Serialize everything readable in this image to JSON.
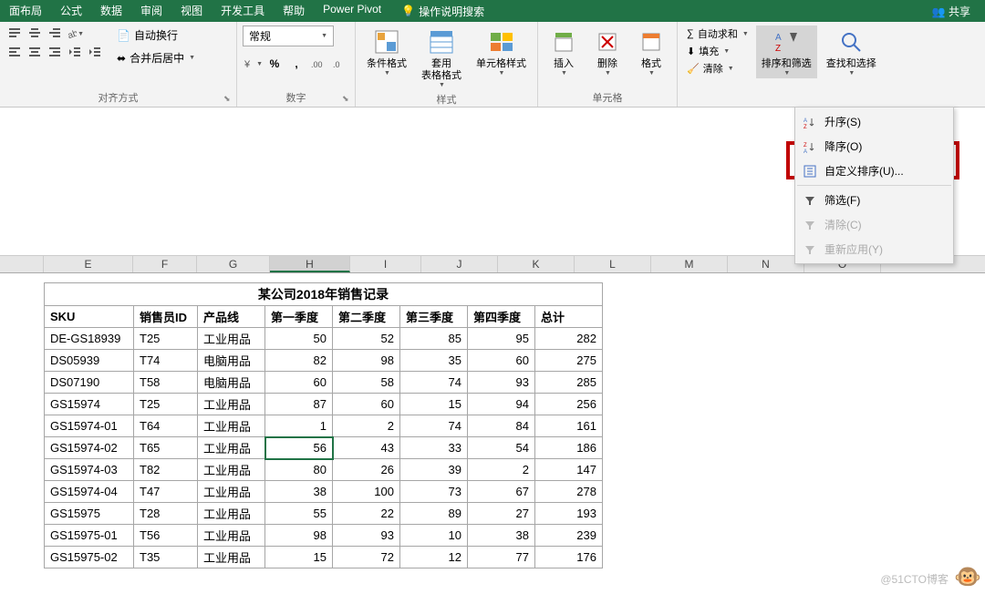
{
  "titlebar": {
    "tabs": [
      "面布局",
      "公式",
      "数据",
      "审阅",
      "视图",
      "开发工具",
      "帮助",
      "Power Pivot"
    ],
    "tell_me": "操作说明搜索",
    "share": "共享"
  },
  "ribbon": {
    "alignment": {
      "wrap": "自动换行",
      "merge": "合并后居中",
      "label": "对齐方式"
    },
    "number": {
      "format": "常规",
      "label": "数字"
    },
    "styles": {
      "cond": "条件格式",
      "table": "套用\n表格格式",
      "cell": "单元格样式",
      "label": "样式"
    },
    "cells": {
      "insert": "插入",
      "delete": "删除",
      "format": "格式",
      "label": "单元格"
    },
    "editing": {
      "sum": "自动求和",
      "fill": "填充",
      "clear": "清除",
      "sort": "排序和筛选",
      "find": "查找和选择"
    }
  },
  "menu": {
    "asc": "升序(S)",
    "desc": "降序(O)",
    "custom": "自定义排序(U)...",
    "filter": "筛选(F)",
    "clear": "清除(C)",
    "reapply": "重新应用(Y)"
  },
  "columns": [
    "E",
    "F",
    "G",
    "H",
    "I",
    "J",
    "K",
    "L",
    "M",
    "N",
    "O"
  ],
  "table": {
    "title": "某公司2018年销售记录",
    "headers": [
      "SKU",
      "销售员ID",
      "产品线",
      "第一季度",
      "第二季度",
      "第三季度",
      "第四季度",
      "总计"
    ],
    "rows": [
      [
        "DE-GS18939",
        "T25",
        "工业用品",
        50,
        52,
        85,
        95,
        282
      ],
      [
        "DS05939",
        "T74",
        "电脑用品",
        82,
        98,
        35,
        60,
        275
      ],
      [
        "DS07190",
        "T58",
        "电脑用品",
        60,
        58,
        74,
        93,
        285
      ],
      [
        "GS15974",
        "T25",
        "工业用品",
        87,
        60,
        15,
        94,
        256
      ],
      [
        "GS15974-01",
        "T64",
        "工业用品",
        1,
        2,
        74,
        84,
        161
      ],
      [
        "GS15974-02",
        "T65",
        "工业用品",
        56,
        43,
        33,
        54,
        186
      ],
      [
        "GS15974-03",
        "T82",
        "工业用品",
        80,
        26,
        39,
        2,
        147
      ],
      [
        "GS15974-04",
        "T47",
        "工业用品",
        38,
        100,
        73,
        67,
        278
      ],
      [
        "GS15975",
        "T28",
        "工业用品",
        55,
        22,
        89,
        27,
        193
      ],
      [
        "GS15975-01",
        "T56",
        "工业用品",
        98,
        93,
        10,
        38,
        239
      ],
      [
        "GS15975-02",
        "T35",
        "工业用品",
        15,
        72,
        12,
        77,
        176
      ]
    ]
  },
  "watermark": "@51CTO博客",
  "selected_cell": {
    "row": 5,
    "col": 3
  }
}
